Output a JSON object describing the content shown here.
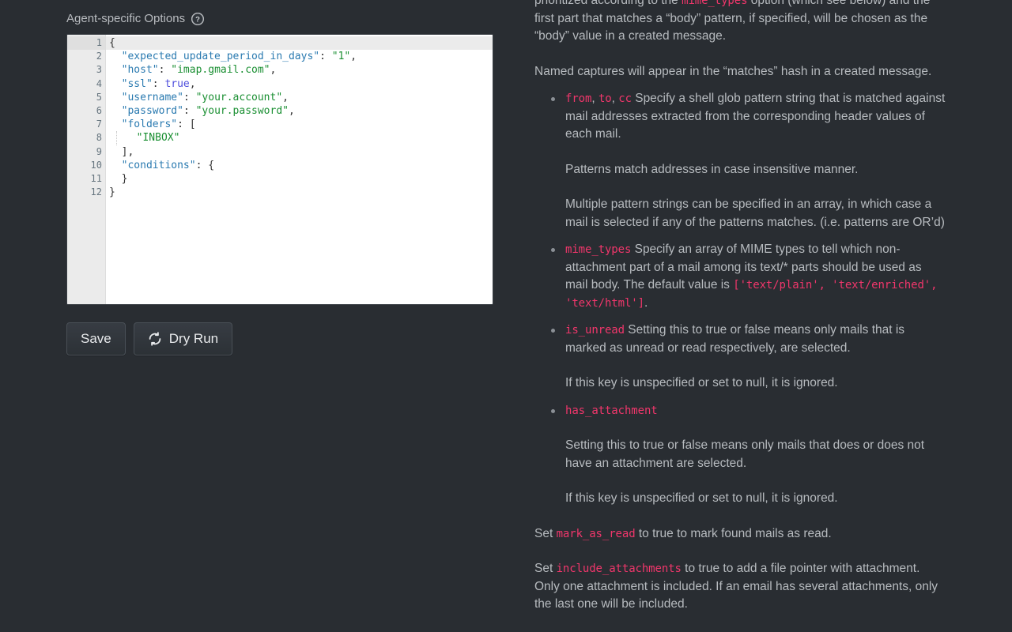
{
  "form": {
    "label": "Agent-specific Options",
    "help_icon": "question-mark-circle-icon",
    "help_tooltip": "?"
  },
  "editor": {
    "language": "json",
    "active_line": 1,
    "total_lines": 12,
    "gutter_numbers": [
      "1",
      "2",
      "3",
      "4",
      "5",
      "6",
      "7",
      "8",
      "9",
      "10",
      "11",
      "12"
    ],
    "fold_lines": [
      1,
      7,
      10
    ],
    "fold_glyph": "▾",
    "lines": [
      {
        "n": 1,
        "tokens": [
          {
            "t": "punc",
            "v": "{"
          }
        ]
      },
      {
        "n": 2,
        "tokens": [
          {
            "t": "plain",
            "v": "  "
          },
          {
            "t": "key",
            "v": "\"expected_update_period_in_days\""
          },
          {
            "t": "punc",
            "v": ": "
          },
          {
            "t": "str",
            "v": "\"1\""
          },
          {
            "t": "punc",
            "v": ","
          }
        ]
      },
      {
        "n": 3,
        "tokens": [
          {
            "t": "plain",
            "v": "  "
          },
          {
            "t": "key",
            "v": "\"host\""
          },
          {
            "t": "punc",
            "v": ": "
          },
          {
            "t": "str",
            "v": "\"imap.gmail.com\""
          },
          {
            "t": "punc",
            "v": ","
          }
        ]
      },
      {
        "n": 4,
        "tokens": [
          {
            "t": "plain",
            "v": "  "
          },
          {
            "t": "key",
            "v": "\"ssl\""
          },
          {
            "t": "punc",
            "v": ": "
          },
          {
            "t": "bool",
            "v": "true"
          },
          {
            "t": "punc",
            "v": ","
          }
        ]
      },
      {
        "n": 5,
        "tokens": [
          {
            "t": "plain",
            "v": "  "
          },
          {
            "t": "key",
            "v": "\"username\""
          },
          {
            "t": "punc",
            "v": ": "
          },
          {
            "t": "str",
            "v": "\"your.account\""
          },
          {
            "t": "punc",
            "v": ","
          }
        ]
      },
      {
        "n": 6,
        "tokens": [
          {
            "t": "plain",
            "v": "  "
          },
          {
            "t": "key",
            "v": "\"password\""
          },
          {
            "t": "punc",
            "v": ": "
          },
          {
            "t": "str",
            "v": "\"your.password\""
          },
          {
            "t": "punc",
            "v": ","
          }
        ]
      },
      {
        "n": 7,
        "tokens": [
          {
            "t": "plain",
            "v": "  "
          },
          {
            "t": "key",
            "v": "\"folders\""
          },
          {
            "t": "punc",
            "v": ": ["
          }
        ]
      },
      {
        "n": 8,
        "guide": true,
        "tokens": [
          {
            "t": "plain",
            "v": "  "
          },
          {
            "t": "str",
            "v": "\"INBOX\""
          }
        ]
      },
      {
        "n": 9,
        "tokens": [
          {
            "t": "plain",
            "v": "  "
          },
          {
            "t": "punc",
            "v": "],"
          }
        ]
      },
      {
        "n": 10,
        "tokens": [
          {
            "t": "plain",
            "v": "  "
          },
          {
            "t": "key",
            "v": "\"conditions\""
          },
          {
            "t": "punc",
            "v": ": {"
          }
        ]
      },
      {
        "n": 11,
        "tokens": [
          {
            "t": "plain",
            "v": "  "
          },
          {
            "t": "punc",
            "v": "}"
          }
        ]
      },
      {
        "n": 12,
        "tokens": [
          {
            "t": "punc",
            "v": "}"
          }
        ]
      }
    ]
  },
  "buttons": {
    "save": {
      "label": "Save"
    },
    "dry_run": {
      "label": "Dry Run",
      "icon": "refresh-sync-icon"
    }
  },
  "docs": {
    "blocks": [
      {
        "kind": "paragraph",
        "name": "doc-paragraph-mime-priority",
        "parts": [
          {
            "t": "text",
            "v": "prioritized according to the "
          },
          {
            "t": "code",
            "v": "mime_types"
          },
          {
            "t": "text",
            "v": " option (which see below) and the first part that matches a “body” pattern, if specified, will be chosen as the “body” value in a created message."
          }
        ]
      },
      {
        "kind": "paragraph",
        "name": "doc-paragraph-named-captures",
        "parts": [
          {
            "t": "text",
            "v": "Named captures will appear in the “matches” hash in a created message."
          }
        ]
      },
      {
        "kind": "bullet",
        "name": "doc-bullet-from-to-cc",
        "paragraphs": [
          {
            "parts": [
              {
                "t": "code",
                "v": "from"
              },
              {
                "t": "text",
                "v": ", "
              },
              {
                "t": "code",
                "v": "to"
              },
              {
                "t": "text",
                "v": ", "
              },
              {
                "t": "code",
                "v": "cc"
              },
              {
                "t": "text",
                "v": " Specify a shell glob pattern string that is matched against mail addresses extracted from the corresponding header values of each mail."
              }
            ]
          },
          {
            "parts": [
              {
                "t": "text",
                "v": "Patterns match addresses in case insensitive manner."
              }
            ]
          },
          {
            "parts": [
              {
                "t": "text",
                "v": "Multiple pattern strings can be specified in an array, in which case a mail is selected if any of the patterns matches. (i.e. patterns are OR’d)"
              }
            ]
          }
        ]
      },
      {
        "kind": "bullet",
        "name": "doc-bullet-mime-types",
        "paragraphs": [
          {
            "parts": [
              {
                "t": "code",
                "v": "mime_types"
              },
              {
                "t": "text",
                "v": " Specify an array of MIME types to tell which non-attachment part of a mail among its text/* parts should be used as mail body. The default value is "
              },
              {
                "t": "code",
                "v": "['text/plain', 'text/enriched', 'text/html']"
              },
              {
                "t": "text",
                "v": "."
              }
            ]
          }
        ]
      },
      {
        "kind": "bullet",
        "name": "doc-bullet-is-unread",
        "paragraphs": [
          {
            "parts": [
              {
                "t": "code",
                "v": "is_unread"
              },
              {
                "t": "text",
                "v": " Setting this to true or false means only mails that is marked as unread or read respectively, are selected."
              }
            ]
          },
          {
            "parts": [
              {
                "t": "text",
                "v": "If this key is unspecified or set to null, it is ignored."
              }
            ]
          }
        ]
      },
      {
        "kind": "bullet",
        "name": "doc-bullet-has-attachment",
        "paragraphs": [
          {
            "parts": [
              {
                "t": "code",
                "v": "has_attachment"
              }
            ]
          },
          {
            "parts": [
              {
                "t": "text",
                "v": "Setting this to true or false means only mails that does or does not have an attachment are selected."
              }
            ]
          },
          {
            "parts": [
              {
                "t": "text",
                "v": "If this key is unspecified or set to null, it is ignored."
              }
            ]
          }
        ]
      },
      {
        "kind": "paragraph",
        "name": "doc-paragraph-mark-as-read",
        "parts": [
          {
            "t": "text",
            "v": "Set "
          },
          {
            "t": "code",
            "v": "mark_as_read"
          },
          {
            "t": "text",
            "v": " to true to mark found mails as read."
          }
        ]
      },
      {
        "kind": "paragraph",
        "name": "doc-paragraph-include-attachments",
        "parts": [
          {
            "t": "text",
            "v": "Set "
          },
          {
            "t": "code",
            "v": "include_attachments"
          },
          {
            "t": "text",
            "v": " to true to add a file pointer with attachment. Only one attachment is included. If an email has several attachments, only the last one will be included."
          }
        ]
      }
    ]
  },
  "colors": {
    "page_background": "#292d32",
    "editor_background": "#ffffff",
    "gutter_background": "#ebebeb",
    "doc_text": "#b7bbbf",
    "code_accent": "#f0366b",
    "json_key": "#2a7ab0",
    "json_string": "#1a8f32",
    "json_boolean": "#4f4fdd",
    "button_face": "#32373d"
  }
}
